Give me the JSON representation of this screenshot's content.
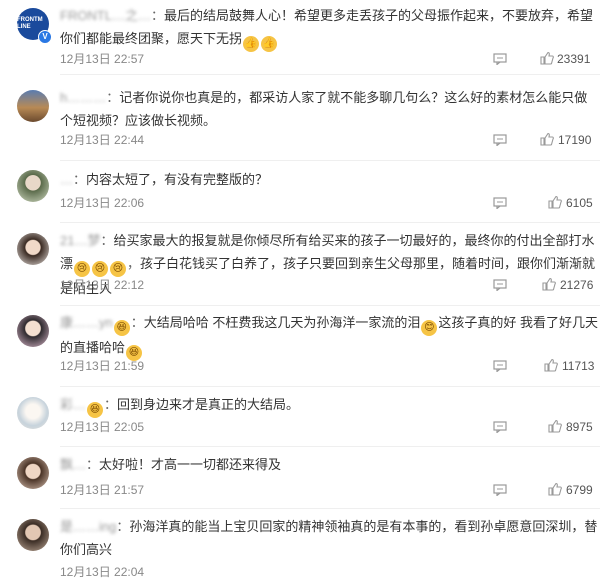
{
  "comments": [
    {
      "username": "FRONTL…之…",
      "text_before": "最后的结局鼓舞人心！希望更多走丢孩子的父母振作起来，不要放弃，希望你们都能最终团聚，愿天下无拐",
      "text_after": "",
      "date": "12月13日",
      "time": "22:57",
      "likes": "23391",
      "emoji_count": 2,
      "avatar_label": "FRONTM LINE",
      "verified": true
    },
    {
      "username": "h………",
      "text_before": "记者你说你也真是的，都采访人家了就不能多聊几句么？这么好的素材怎么能只做个短视频？应该做长视频。",
      "text_after": "",
      "date": "12月13日",
      "time": "22:44",
      "likes": "17190"
    },
    {
      "username": "…",
      "text_before": "内容太短了，有没有完整版的？",
      "text_after": "",
      "date": "12月13日",
      "time": "22:06",
      "likes": "6105"
    },
    {
      "username": "21…梦",
      "text_before": "给买家最大的报复就是你倾尽所有给买来的孩子一切最好的，最终你的付出全部打水漂",
      "text_after": "孩子白花钱买了白养了，孩子只要回到亲生父母那里，随着时间，跟你们渐渐就是陌生人",
      "date": "12月13日",
      "time": "22:12",
      "likes": "21276"
    },
    {
      "username": "康……yn",
      "text_before": "大结局哈哈 不枉费我这几天为孙海洋一家流的泪",
      "text_middle": "这孩子真的好 我看了好几天的直播哈哈",
      "text_after": "",
      "date": "12月13日",
      "time": "21:59",
      "likes": "11713"
    },
    {
      "username": "彩…",
      "text_before": "回到身边来才是真正的大结局。",
      "text_after": "",
      "date": "12月13日",
      "time": "22:05",
      "likes": "8975"
    },
    {
      "username": "飘…",
      "text_before": "太好啦！才高一一切都还来得及",
      "text_after": "",
      "date": "12月13日",
      "time": "21:57",
      "likes": "6799"
    },
    {
      "username": "是……ing",
      "text_before": "孙海洋真的能当上宝贝回家的精神领袖真的是有本事的，看到孙卓愿意回深圳，替你们高兴",
      "text_after": "",
      "date": "12月13日",
      "time": "22:04",
      "likes": ""
    }
  ],
  "colors": {
    "time": "#888888",
    "text": "#333333",
    "verified_badge": "#2a78e4",
    "emoji": "#f6c445"
  },
  "icons": {
    "reply": "comment-reply-icon",
    "like": "thumbs-up-icon",
    "verified": "verified-v-icon"
  }
}
